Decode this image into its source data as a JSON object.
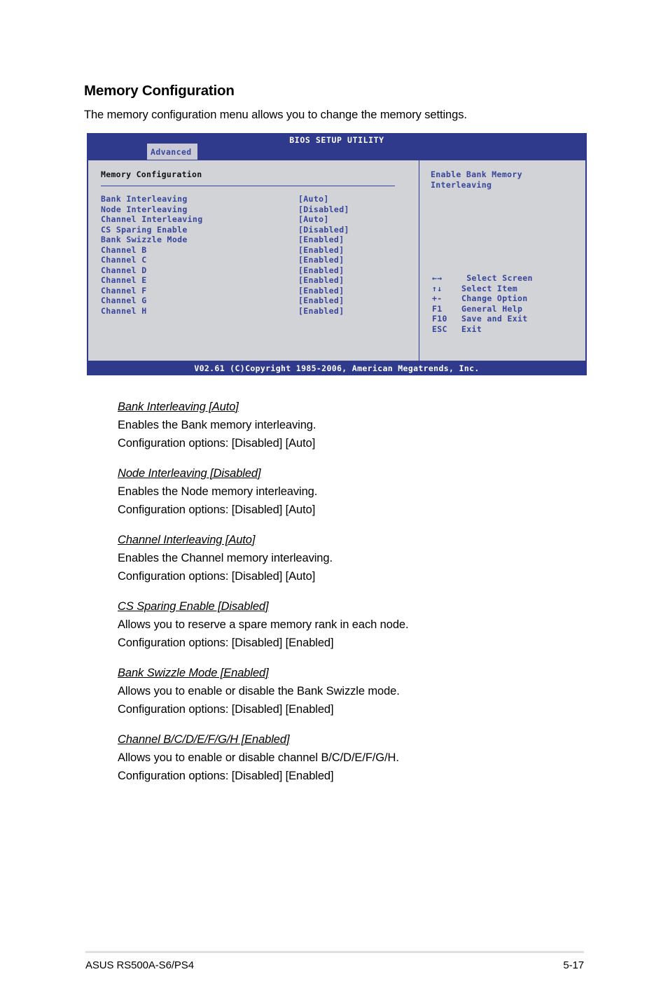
{
  "page": {
    "section_title": "Memory Configuration",
    "section_intro": "The memory configuration menu allows you to change the memory settings.",
    "footer_left": "ASUS RS500A-S6/PS4",
    "footer_right": "5-17"
  },
  "bios": {
    "title": "BIOS SETUP UTILITY",
    "active_tab": "Advanced",
    "panel_heading": "Memory Configuration",
    "options": [
      {
        "label": "Bank Interleaving",
        "value": "[Auto]"
      },
      {
        "label": "Node Interleaving",
        "value": "[Disabled]"
      },
      {
        "label": "Channel Interleaving",
        "value": "[Auto]"
      },
      {
        "label": "CS Sparing Enable",
        "value": "[Disabled]"
      },
      {
        "label": "Bank Swizzle Mode",
        "value": "[Enabled]"
      },
      {
        "label": "Channel B",
        "value": "[Enabled]"
      },
      {
        "label": "Channel C",
        "value": "[Enabled]"
      },
      {
        "label": "Channel D",
        "value": "[Enabled]"
      },
      {
        "label": "Channel E",
        "value": "[Enabled]"
      },
      {
        "label": "Channel F",
        "value": "[Enabled]"
      },
      {
        "label": "Channel G",
        "value": "[Enabled]"
      },
      {
        "label": "Channel H",
        "value": "[Enabled]"
      }
    ],
    "help_text": "Enable Bank Memory\nInterleaving",
    "key_legend": [
      {
        "keys": "←→",
        "desc": " Select Screen"
      },
      {
        "keys": "↑↓",
        "desc": "Select Item"
      },
      {
        "keys": "+-",
        "desc": "Change Option"
      },
      {
        "keys": "F1",
        "desc": "General Help"
      },
      {
        "keys": "F10",
        "desc": "Save and Exit"
      },
      {
        "keys": "ESC",
        "desc": "Exit"
      }
    ],
    "copyright": "V02.61 (C)Copyright 1985-2006, American Megatrends, Inc.",
    "colors": {
      "header_blue": "#2f3a8c",
      "text_blue": "#37459b",
      "panel_gray": "#d2d3d7",
      "tab_gray": "#c9cad6"
    }
  },
  "descriptions": [
    {
      "head": "Bank Interleaving [Auto]",
      "line1": "Enables the Bank memory interleaving.",
      "line2": "Configuration options: [Disabled] [Auto]"
    },
    {
      "head": "Node Interleaving [Disabled]",
      "line1": "Enables the Node memory interleaving.",
      "line2": "Configuration options: [Disabled] [Auto]"
    },
    {
      "head": "Channel Interleaving [Auto]",
      "line1": "Enables the Channel memory interleaving.",
      "line2": "Configuration options: [Disabled] [Auto]"
    },
    {
      "head": "CS Sparing Enable [Disabled]",
      "line1": "Allows you to reserve a spare memory rank in each node.",
      "line2": "Configuration options: [Disabled] [Enabled]"
    },
    {
      "head": "Bank Swizzle Mode [Enabled]",
      "line1": "Allows you to enable or disable the Bank Swizzle mode.",
      "line2": "Configuration options: [Disabled] [Enabled]"
    },
    {
      "head": "Channel B/C/D/E/F/G/H [Enabled]",
      "line1": "Allows you to enable or disable channel B/C/D/E/F/G/H.",
      "line2": "Configuration options: [Disabled] [Enabled]"
    }
  ]
}
